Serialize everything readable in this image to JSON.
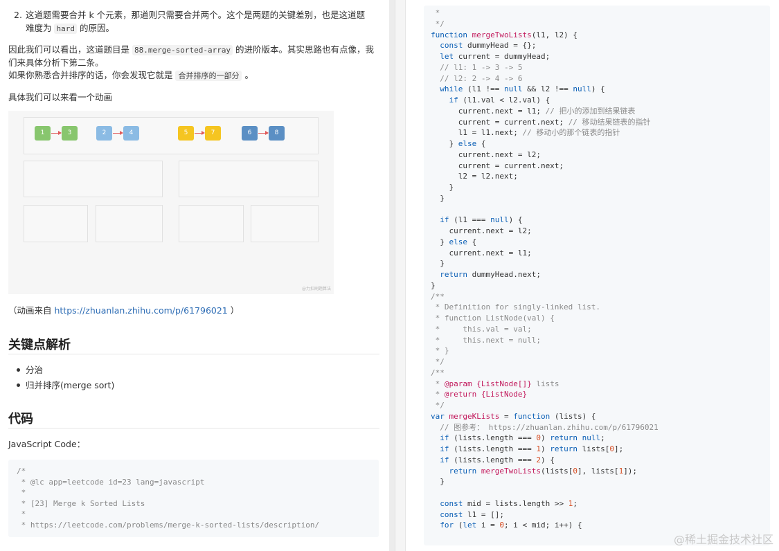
{
  "left": {
    "item2_num": "2.",
    "item2_line1_a": "这道题需要合并 k 个元素，那道则只需要合并两个。这个是两题的关键差别，也是这道题",
    "item2_line2_a": "难度为 ",
    "item2_line2_code": "hard",
    "item2_line2_b": " 的原因。",
    "p1_line1_a": "因此我们可以看出，这道题目是 ",
    "p1_line1_code": "88.merge-sorted-array",
    "p1_line1_b": " 的进阶版本。其实思路也有点像，我",
    "p1_line2": "们来具体分析下第二条。",
    "p1_line3_a": "如果你熟悉合并排序的话，你会发现它就是 ",
    "p1_line3_box": "合并排序的一部分",
    "p1_line3_b": " 。",
    "p2": "具体我们可以来看一个动画",
    "anim_nodes": [
      "1",
      "3",
      "2",
      "4",
      "5",
      "7",
      "6",
      "8"
    ],
    "anim_watermark": "@力扣刷题算法",
    "source_a": "（动画来自 ",
    "source_link": "https://zhuanlan.zhihu.com/p/61796021",
    "source_b": " ）",
    "h_keypoints": "关键点解析",
    "bullets": [
      "分治",
      "归并排序(merge sort)"
    ],
    "h_code": "代码",
    "code_label": "JavaScript Code：",
    "code_lines": [
      "/*",
      " * @lc app=leetcode id=23 lang=javascript",
      " *",
      " * [23] Merge k Sorted Lists",
      " *",
      " * https://leetcode.com/problems/merge-k-sorted-lists/description/"
    ]
  },
  "colors": {
    "green": "#88c66e",
    "blue_light": "#8bbbe4",
    "yellow": "#f5c521",
    "blue_dark": "#5b8fc4",
    "arrow": "#e05a5a",
    "link": "#2e6db5"
  },
  "right": {
    "lines": [
      " *",
      " */",
      "function mergeTwoLists(l1, l2) {",
      "  const dummyHead = {};",
      "  let current = dummyHead;",
      "  // l1: 1 -> 3 -> 5",
      "  // l2: 2 -> 4 -> 6",
      "  while (l1 !== null && l2 !== null) {",
      "    if (l1.val < l2.val) {",
      "      current.next = l1; // 把小的添加到结果链表",
      "      current = current.next; // 移动结果链表的指针",
      "      l1 = l1.next; // 移动小的那个链表的指针",
      "    } else {",
      "      current.next = l2;",
      "      current = current.next;",
      "      l2 = l2.next;",
      "    }",
      "  }",
      "",
      "  if (l1 === null) {",
      "    current.next = l2;",
      "  } else {",
      "    current.next = l1;",
      "  }",
      "  return dummyHead.next;",
      "}",
      "/**",
      " * Definition for singly-linked list.",
      " * function ListNode(val) {",
      " *     this.val = val;",
      " *     this.next = null;",
      " * }",
      " */",
      "/**",
      " * @param {ListNode[]} lists",
      " * @return {ListNode}",
      " */",
      "var mergeKLists = function (lists) {",
      "  // 图参考： https://zhuanlan.zhihu.com/p/61796021",
      "  if (lists.length === 0) return null;",
      "  if (lists.length === 1) return lists[0];",
      "  if (lists.length === 2) {",
      "    return mergeTwoLists(lists[0], lists[1]);",
      "  }",
      "",
      "  const mid = lists.length >> 1;",
      "  const l1 = [];",
      "  for (let i = 0; i < mid; i++) {"
    ]
  },
  "watermark": "@稀土掘金技术社区"
}
